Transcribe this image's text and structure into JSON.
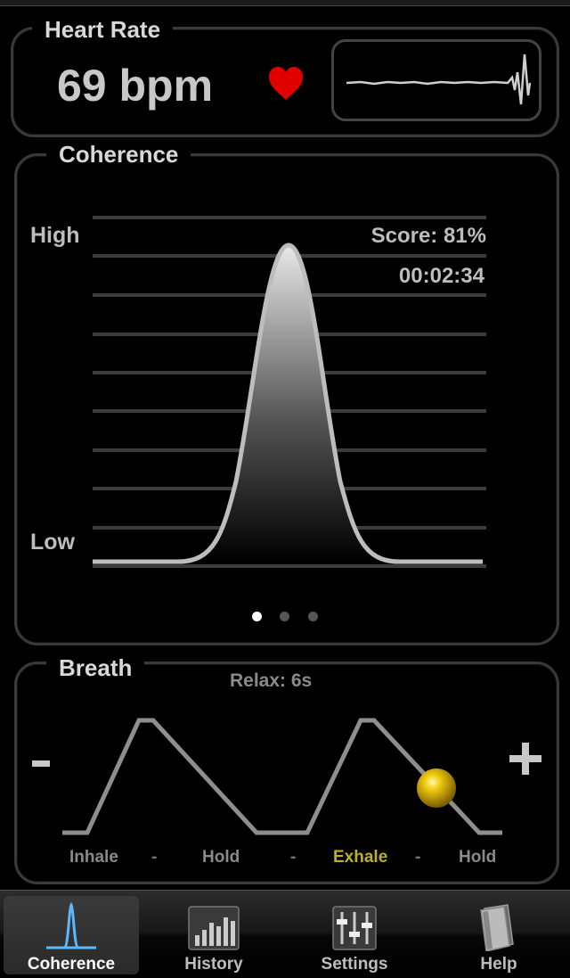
{
  "heart_rate": {
    "title": "Heart Rate",
    "value": "69 bpm"
  },
  "coherence": {
    "title": "Coherence",
    "high_label": "High",
    "low_label": "Low",
    "score": "Score:  81%",
    "timer": "00:02:34",
    "page_count": 3,
    "active_page": 1
  },
  "breath": {
    "title": "Breath",
    "relax": "Relax: 6s",
    "minus_label": "-",
    "plus_label": "+",
    "phases": [
      {
        "label": "Inhale",
        "active": false
      },
      {
        "label": "Hold",
        "active": false
      },
      {
        "label": "Exhale",
        "active": true
      },
      {
        "label": "Hold",
        "active": false
      }
    ],
    "separator": "-"
  },
  "tabs": [
    {
      "label": "Coherence",
      "icon": "coherence-icon",
      "active": true
    },
    {
      "label": "History",
      "icon": "history-icon",
      "active": false
    },
    {
      "label": "Settings",
      "icon": "settings-icon",
      "active": false
    },
    {
      "label": "Help",
      "icon": "help-icon",
      "active": false
    }
  ],
  "colors": {
    "heart": "#e00000",
    "exhale_active": "#b9b227",
    "tab_icon_active": "#5ab8ff",
    "ball": "#e0b800"
  }
}
